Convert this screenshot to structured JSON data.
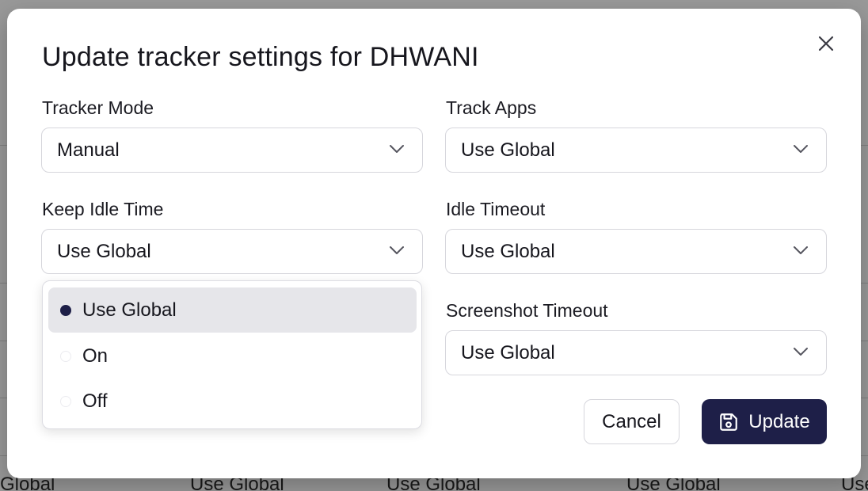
{
  "background": {
    "row_values": [
      "Global",
      "Use Global",
      "Use Global",
      "Use Global",
      "Use"
    ]
  },
  "modal": {
    "title": "Update tracker settings for DHWANI",
    "fields": {
      "tracker_mode": {
        "label": "Tracker Mode",
        "value": "Manual"
      },
      "track_apps": {
        "label": "Track Apps",
        "value": "Use Global"
      },
      "keep_idle_time": {
        "label": "Keep Idle Time",
        "value": "Use Global"
      },
      "idle_timeout": {
        "label": "Idle Timeout",
        "value": "Use Global"
      },
      "screenshot_timeout": {
        "label": "Screenshot Timeout",
        "value": "Use Global"
      }
    },
    "dropdown": {
      "options": [
        {
          "label": "Use Global",
          "selected": true
        },
        {
          "label": "On",
          "selected": false
        },
        {
          "label": "Off",
          "selected": false
        }
      ]
    },
    "buttons": {
      "cancel": "Cancel",
      "update": "Update"
    }
  },
  "colors": {
    "primary": "#1e1f48",
    "selected_option_bg": "#e6e6ea",
    "border": "#d6d6dc"
  },
  "icons": {
    "close": "close-icon",
    "chevron": "chevron-down-icon",
    "save": "save-icon"
  }
}
